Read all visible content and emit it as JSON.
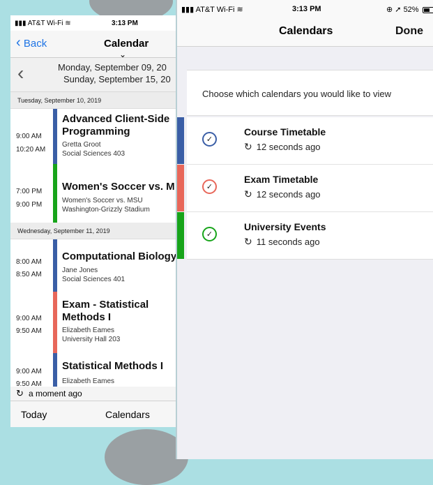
{
  "left_screen": {
    "status": {
      "carrier": "AT&T Wi-Fi",
      "time": "3:13 PM"
    },
    "nav": {
      "back_label": "Back",
      "title": "Calendar"
    },
    "week": {
      "start": "Monday, September 09, 20",
      "end": "Sunday, September 15, 20"
    },
    "days": [
      {
        "header": "Tuesday, September 10, 2019"
      },
      {
        "header": "Wednesday, September 11, 2019"
      }
    ],
    "events": [
      {
        "time_start": "9:00 AM",
        "time_end": "10:20 AM",
        "title": "Advanced Client-Side",
        "title2": "Programming",
        "sub1": "Gretta Groot",
        "sub2": "Social Sciences 403",
        "color": "#3a5ea6"
      },
      {
        "time_start": "7:00 PM",
        "time_end": "9:00 PM",
        "title": "Women's Soccer vs. M",
        "title2": "",
        "sub1": "Women's Soccer vs. MSU",
        "sub2": "Washington-Grizzly Stadium",
        "color": "#17a41a"
      },
      {
        "time_start": "8:00 AM",
        "time_end": "8:50 AM",
        "title": "Computational Biology",
        "title2": "",
        "sub1": "Jane Jones",
        "sub2": "Social Sciences 401",
        "color": "#3a5ea6"
      },
      {
        "time_start": "9:00 AM",
        "time_end": "9:50 AM",
        "title": "Exam - Statistical",
        "title2": "Methods I",
        "sub1": "Elizabeth Eames",
        "sub2": "University Hall 203",
        "color": "#e8675a"
      },
      {
        "time_start": "9:00 AM",
        "time_end": "9:50 AM",
        "title": "Statistical Methods I",
        "title2": "",
        "sub1": "Elizabeth Eames",
        "sub2": "",
        "color": "#3a5ea6"
      }
    ],
    "sync_text": "a moment ago",
    "tabbar": {
      "today": "Today",
      "calendars": "Calendars"
    }
  },
  "right_screen": {
    "status": {
      "carrier": "AT&T Wi-Fi",
      "time": "3:13 PM",
      "battery": "52%"
    },
    "nav": {
      "title": "Calendars",
      "done": "Done"
    },
    "instruction": "Choose which calendars you would like to view",
    "calendars": [
      {
        "name": "Course Timetable",
        "synced": "12 seconds ago",
        "color": "#3a5ea6"
      },
      {
        "name": "Exam Timetable",
        "synced": "12 seconds ago",
        "color": "#e8675a"
      },
      {
        "name": "University Events",
        "synced": "11 seconds ago",
        "color": "#17a41a"
      }
    ]
  }
}
